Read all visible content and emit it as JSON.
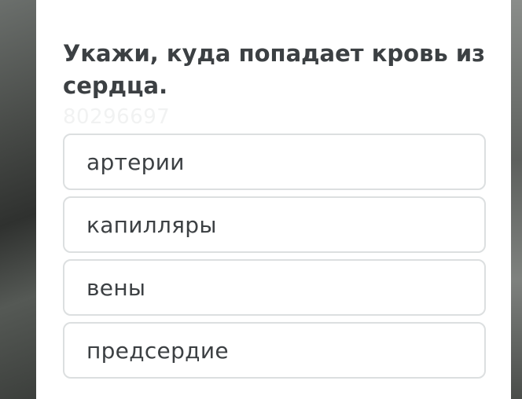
{
  "question": {
    "text": "Укажи, куда попадает кровь из сердца.",
    "watermark": "80296697"
  },
  "options": [
    {
      "label": "артерии"
    },
    {
      "label": "капилляры"
    },
    {
      "label": "вены"
    },
    {
      "label": "предсердие"
    }
  ]
}
